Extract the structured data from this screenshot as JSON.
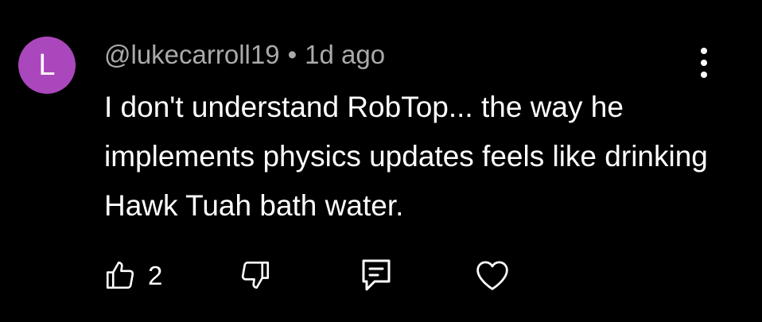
{
  "comment": {
    "avatar_letter": "L",
    "avatar_color": "#ab47bc",
    "username": "@lukecarroll19",
    "separator": "•",
    "timestamp": "1d ago",
    "text": "I don't understand RobTop... the way he implements physics updates feels like drinking Hawk Tuah bath water.",
    "menu_icon": "more-vertical-icon"
  },
  "actions": {
    "like_icon": "thumbs-up-icon",
    "like_count": "2",
    "dislike_icon": "thumbs-down-icon",
    "reply_icon": "reply-icon",
    "heart_icon": "heart-icon"
  },
  "colors": {
    "background": "#000000",
    "text": "#ffffff",
    "meta_text": "#aaaaaa"
  }
}
